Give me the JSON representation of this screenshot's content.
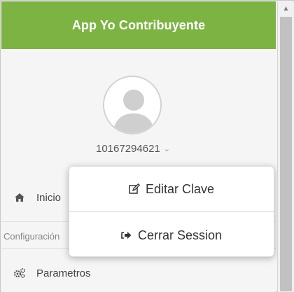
{
  "header": {
    "title": "App Yo Contribuyente",
    "color": "#7cb342"
  },
  "user": {
    "id": "10167294621",
    "avatar_icon": "user-silhouette-icon",
    "toggle_icon": "chevron-down-icon"
  },
  "nav": {
    "inicio": {
      "label": "Inicio",
      "icon": "home-icon"
    },
    "configuracion": {
      "label": "Configuración"
    },
    "parametros": {
      "label": "Parametros",
      "icon": "gears-icon"
    }
  },
  "dropdown": {
    "items": [
      {
        "label": "Editar Clave",
        "icon": "edit-icon"
      },
      {
        "label": "Cerrar Session",
        "icon": "sign-out-icon"
      }
    ]
  },
  "scrollbar": {
    "up_icon": "scroll-up-arrow-icon"
  }
}
